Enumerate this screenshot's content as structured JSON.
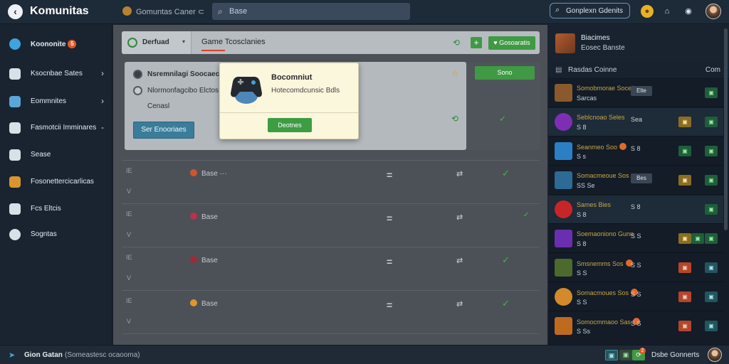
{
  "topbar": {
    "back_icon": "back-arrow-icon",
    "title": "Komunitas",
    "breadcrumb": "Gomuntas Caner  ⊂",
    "search_placeholder": "Base",
    "right_search_placeholder": "Gonplexn Gdenits"
  },
  "sidebar": {
    "items": [
      {
        "label": "Koononite",
        "icon": "shield-icon",
        "badge": "5"
      },
      {
        "label": "Ksocnbae Sates",
        "icon": "monitor-icon",
        "chevron": "›"
      },
      {
        "label": "Eommnites",
        "icon": "folder-icon",
        "chevron": "›"
      },
      {
        "label": "Fasmotcii Imminares",
        "icon": "search-icon",
        "chevron": "-"
      },
      {
        "label": "Sease",
        "icon": "stack-icon"
      },
      {
        "label": "Fosonettercicarlicas",
        "icon": "package-icon"
      },
      {
        "label": "Fcs Eltcis",
        "icon": "chart-icon"
      },
      {
        "label": "Sogntas",
        "icon": "gear-icon"
      }
    ]
  },
  "filterbar": {
    "dropdown_label": "Derfuad",
    "dropdown_caret": "▾",
    "tab_label": "Game Tcosclanies",
    "button_label": "Gosoaratis"
  },
  "panel": {
    "options": [
      "Nsremnilagi Soocaecos",
      "Nlormonfagcibo Elctos",
      "Cenasl"
    ],
    "button_label": "Ser Enooriaes",
    "side_button_label": "Sono"
  },
  "modal": {
    "title": "Bocomniut",
    "subtitle": "Hotecomdcunsic Bdls",
    "button_label": "Deotnes"
  },
  "table": {
    "rows": [
      {
        "key": "IE",
        "val": "V",
        "game": "Base ···",
        "eq": "=",
        "sw": "⇄",
        "check": "✓",
        "icon_color": "#d0552a"
      },
      {
        "key": "IE",
        "val": "V",
        "game": "Base",
        "eq": "=",
        "sw": "⇄",
        "check": "✓",
        "icon_color": "#b8324a"
      },
      {
        "key": "IE",
        "val": "V",
        "game": "Base",
        "eq": "=",
        "sw": "⇄",
        "check": "✓",
        "icon_color": "#9c2b3a"
      },
      {
        "key": "IE",
        "val": "V",
        "game": "Base",
        "eq": "=",
        "sw": "⇄",
        "check": "✓",
        "icon_color": "#e0962a"
      }
    ]
  },
  "rpanel": {
    "head_title": "Biacimes",
    "head_sub": "Eosec Banste",
    "sub_label": "Rasdas Coinne",
    "sub_right": "Com",
    "rows": [
      {
        "name": "Somobmorae Socelra",
        "meta": "Sarcas",
        "count": "Elte",
        "chips": [
          "g"
        ],
        "thumb": "#8a5a2e"
      },
      {
        "name": "Seblcnoao Seles",
        "meta": "S 8",
        "val": "Sea",
        "chips": [
          "y",
          "g"
        ],
        "thumb": "#7d2fb3"
      },
      {
        "name": "Seanmeo Soo",
        "meta": "S  s",
        "val": "S 8",
        "chips": [
          "g",
          "g"
        ],
        "thumb": "#2b7fc4"
      },
      {
        "name": "Somacmeoue Sos",
        "meta": "SS Se",
        "count": "Bes",
        "chips": [
          "y",
          "g"
        ],
        "thumb": "#2c6b96"
      },
      {
        "name": "Sames Bies",
        "meta": "S 8",
        "val": "S 8",
        "chips": [
          "g"
        ],
        "thumb": "#c8252a"
      },
      {
        "name": "Soemaoniono Gunn",
        "meta": "S 8",
        "val": "S S",
        "chips": [
          "y",
          "g",
          "g"
        ],
        "thumb": "#6a2fb0"
      },
      {
        "name": "Smsnemms Sos",
        "meta": "S  S",
        "val": "S S",
        "chips": [
          "o",
          "t"
        ],
        "thumb": "#4c6a2e"
      },
      {
        "name": "Somacmoues Sos",
        "meta": "S  S",
        "val": "S  S",
        "chips": [
          "o",
          "t"
        ],
        "thumb": "#d48a2a"
      },
      {
        "name": "Somocmmaoo Sas",
        "meta": "S  Ss",
        "val": "S S",
        "chips": [
          "o",
          "t"
        ],
        "thumb": "#c06a20"
      }
    ]
  },
  "bottombar": {
    "label": "Gion Gatan",
    "sub": "(Someastesc ocaooma)",
    "right_label": "Dsbe Gonnerts",
    "notif_badge": "2"
  }
}
